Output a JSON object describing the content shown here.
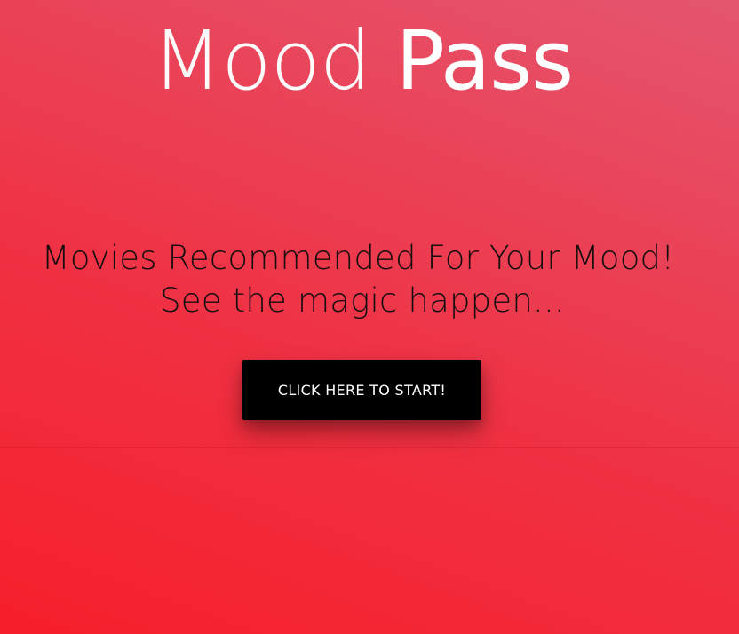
{
  "header": {
    "brand_light": "Mood ",
    "brand_bold": "Pass"
  },
  "hero": {
    "tagline_line1": "Movies Recommended For Your Mood!",
    "tagline_line2": "See the magic happen...",
    "cta_label": "CLICK HERE TO START!"
  },
  "colors": {
    "background_start": "#f61f2b",
    "background_end": "#e4566f",
    "brand_text": "#ffffff",
    "tagline_text": "#160d0f",
    "cta_background": "#000000",
    "cta_text": "#ffffff"
  }
}
